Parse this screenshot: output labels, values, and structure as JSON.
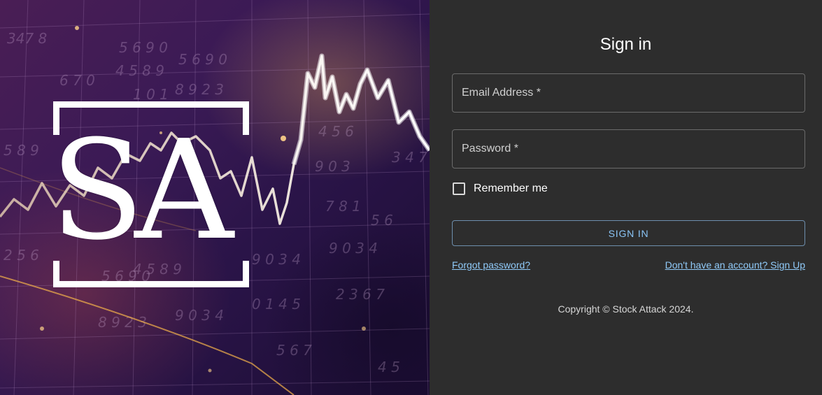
{
  "brand": {
    "logo_text": "SA",
    "hero_numbers": [
      "347 8",
      "5 6 9 0",
      "5 6 9 0",
      "4 5 8 9",
      "6 7 0",
      "8 9 2 3",
      "1 0 1",
      "5 8 9",
      "4 5 6",
      "9 0 3",
      "3 4 7",
      "7 8 1",
      "5 6",
      "9 0 3 4",
      "9 0 3 4",
      "4 5 8 9",
      "5 6 9 0",
      "0 1 4 5",
      "2 3 6 7",
      "9 0 3 4",
      "8 9 2 3",
      "5 6 7",
      "4 5",
      "2 5 6"
    ],
    "accent": "#90caf9"
  },
  "form": {
    "title": "Sign in",
    "email_placeholder": "Email Address *",
    "password_placeholder": "Password *",
    "remember_label": "Remember me",
    "submit_label": "SIGN IN",
    "forgot_link": "Forgot password?",
    "signup_link": "Don't have an account? Sign Up"
  },
  "footer": {
    "copyright": "Copyright © Stock Attack 2024."
  }
}
